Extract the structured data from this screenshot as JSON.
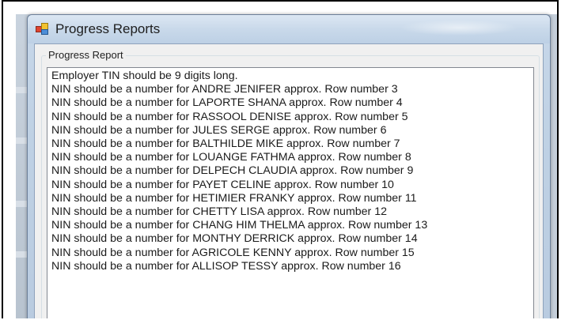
{
  "window": {
    "title": "Progress Reports"
  },
  "group": {
    "label": "Progress Report"
  },
  "report": {
    "lines": [
      "Employer TIN should be 9 digits long.",
      "NIN should be a number for ANDRE JENIFER approx. Row number 3",
      "NIN should be a number for LAPORTE SHANA approx. Row number 4",
      "NIN should be a number for RASSOOL DENISE approx. Row number 5",
      "NIN should be a number for JULES SERGE approx. Row number 6",
      "NIN should be a number for BALTHILDE MIKE approx. Row number 7",
      "NIN should be a number for LOUANGE FATHMA approx. Row number 8",
      "NIN should be a number for DELPECH CLAUDIA approx. Row number 9",
      "NIN should be a number for PAYET CELINE approx. Row number 10",
      "NIN should be a number for HETIMIER FRANKY approx. Row number 11",
      "NIN should be a number for CHETTY LISA approx. Row number 12",
      "NIN should be a number for CHANG HIM THELMA approx. Row number 13",
      "NIN should be a number for MONTHY DERRICK approx. Row number 14",
      "NIN should be a number for AGRICOLE KENNY approx. Row number 15",
      "NIN should be a number for ALLISOP TESSY approx. Row number 16"
    ]
  }
}
